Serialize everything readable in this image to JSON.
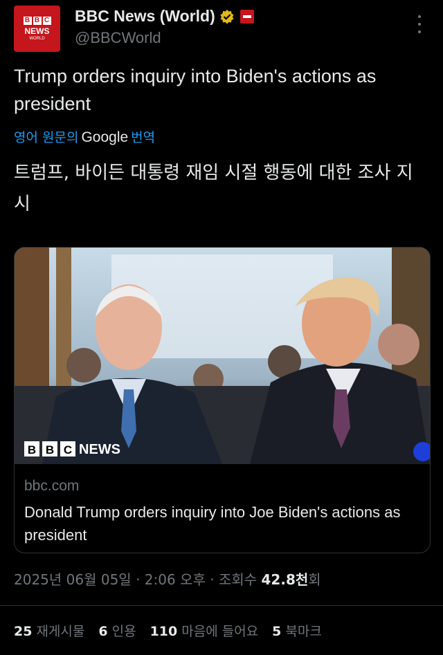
{
  "account": {
    "display_name": "BBC News (World)",
    "handle": "@BBCWorld",
    "avatar": {
      "letters": [
        "B",
        "B",
        "C"
      ],
      "news": "NEWS",
      "world": "WORLD"
    },
    "verified_icon": "gold-verified-badge-icon",
    "affiliation_icon": "bbc-affiliate-badge-icon"
  },
  "tweet": {
    "text": "Trump orders inquiry into Biden's actions as president",
    "translate_prefix": "영어 원문의",
    "translate_brand": "Google",
    "translate_suffix": "번역",
    "translated_text": "트럼프, 바이든 대통령 재임 시절 행동에 대한 조사 지시"
  },
  "card": {
    "image_watermark": "BBC NEWS",
    "image_subjects": [
      "Joe Biden",
      "Donald Trump"
    ],
    "domain": "bbc.com",
    "title": "Donald Trump orders inquiry into Joe Biden's actions as president"
  },
  "meta": {
    "date": "2025년 06월 05일",
    "sep1": "·",
    "time": "2:06 오후",
    "sep2": "·",
    "views_label": "조회수",
    "views_value": "42.8천",
    "views_suffix": "회"
  },
  "stats": {
    "reposts_num": "25",
    "reposts_label": "재게시물",
    "quotes_num": "6",
    "quotes_label": "인용",
    "likes_num": "110",
    "likes_label": "마음에 들어요",
    "bookmarks_num": "5",
    "bookmarks_label": "북마크"
  },
  "colors": {
    "background": "#000000",
    "text": "#e7e9ea",
    "muted": "#71767b",
    "link": "#1d9bf0",
    "bbc_red": "#c4161c",
    "verified_gold": "#e2b719"
  }
}
